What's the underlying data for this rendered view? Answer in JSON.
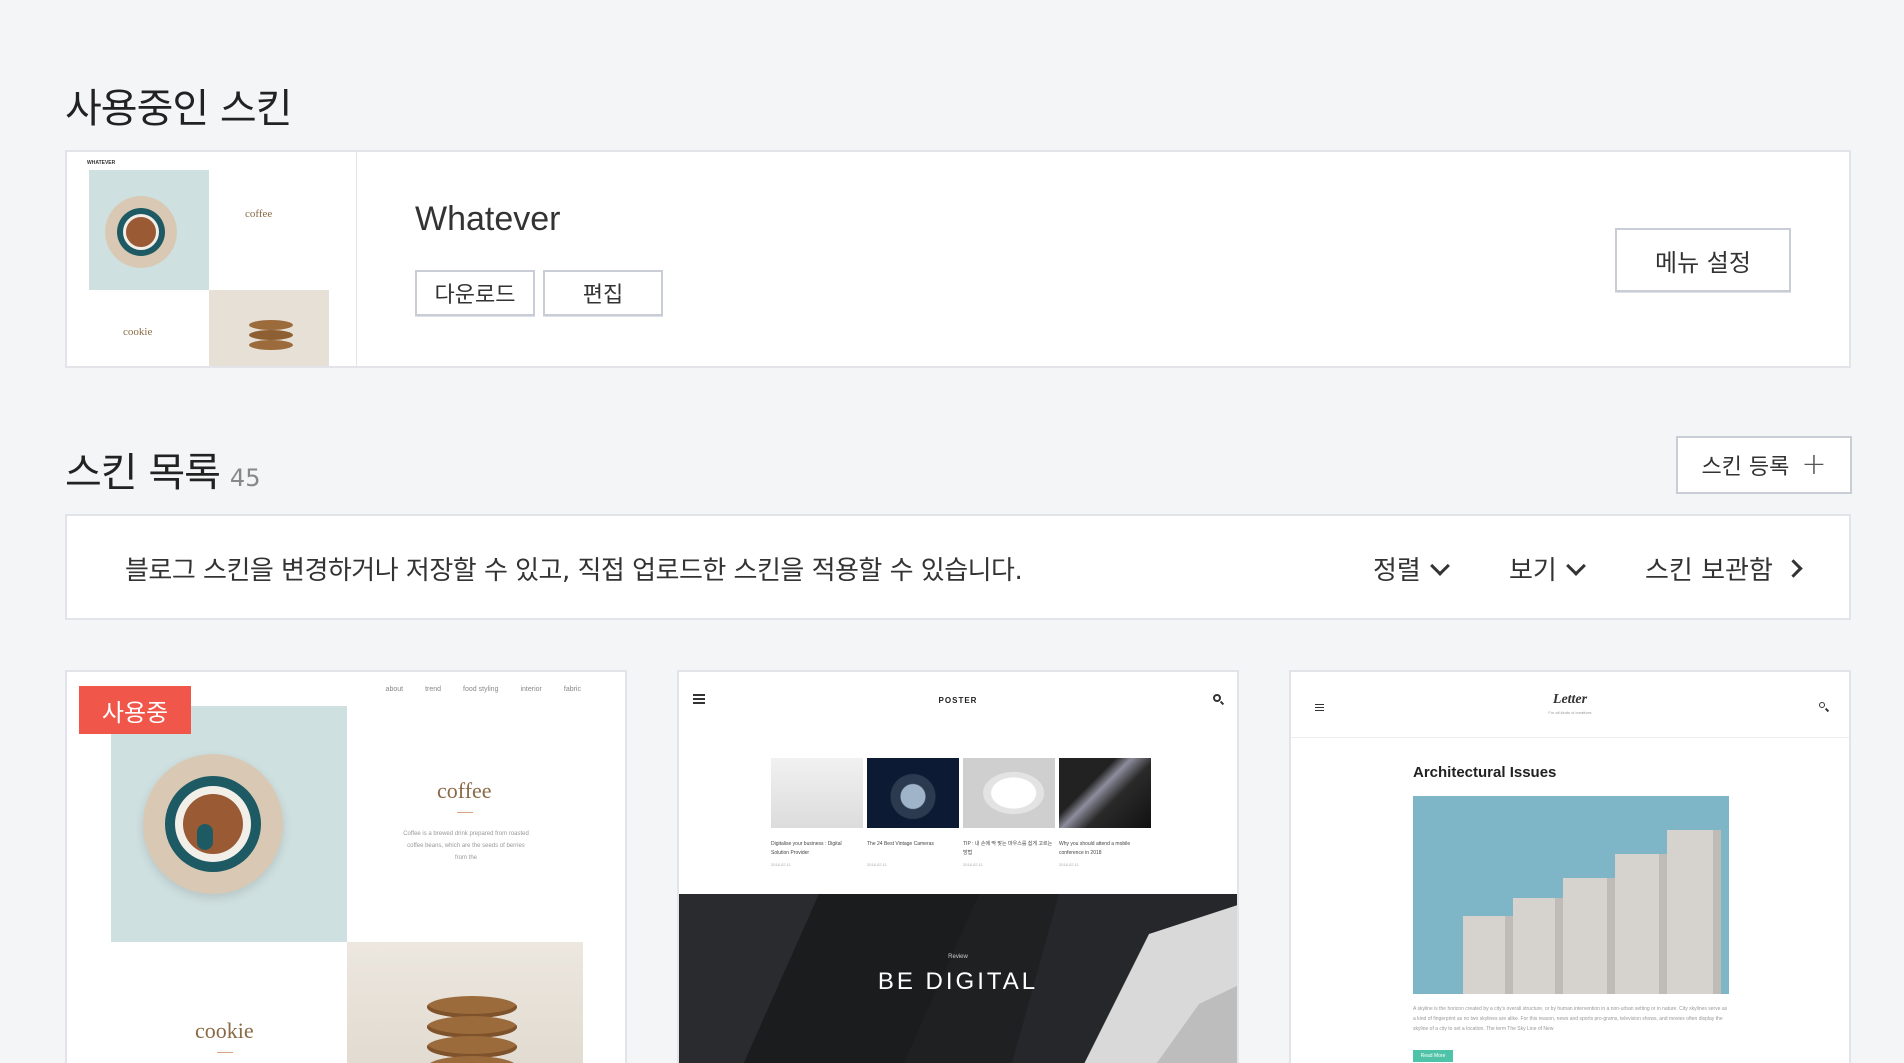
{
  "current": {
    "section_title": "사용중인 스킨",
    "skin_name": "Whatever",
    "download_label": "다운로드",
    "edit_label": "편집",
    "menu_settings_label": "메뉴 설정",
    "thumb": {
      "logo": "WHATEVER",
      "word_coffee": "coffee",
      "word_cookie": "cookie"
    }
  },
  "list": {
    "section_title": "스킨 목록",
    "count": "45",
    "register_label": "스킨 등록",
    "info_text": "블로그 스킨을 변경하거나 저장할 수 있고, 직접 업로드한 스킨을 적용할 수 있습니다.",
    "sort_label": "정렬",
    "view_label": "보기",
    "storage_label": "스킨 보관함"
  },
  "cards": {
    "whatever": {
      "badge": "사용중",
      "nav": [
        "about",
        "trend",
        "food styling",
        "interior",
        "fabric"
      ],
      "word_coffee": "coffee",
      "coffee_desc": "Coffee is a brewed drink prepared from roasted coffee beans, which are the seeds of berries from the",
      "word_cookie": "cookie"
    },
    "poster": {
      "logo": "POSTER",
      "captions": [
        "Digitalise your business : Digital Solution Provider",
        "The 24 Best Vintage Cameras",
        "TIP : 내 손에 딱 맞는 마우스를 쉽게 고르는 방법",
        "Why you should attend a mobile conference in 2018"
      ],
      "dates": [
        "2018.02.11",
        "2018.02.11",
        "2018.02.11",
        "2018.02.11"
      ],
      "hero_kicker": "Review",
      "hero_title": "BE DIGITAL"
    },
    "letter": {
      "logo": "Letter",
      "tagline": "For all kinds of creatives",
      "post_title": "Architectural Issues",
      "post_text": "A skyline is the horizon created by a city's overall structure, or by human intervention in a non-urban setting or in nature. City skylines serve as a kind of fingerprint as no two skylines are alike. For this reason, news and sports pro-grams, television shows, and movies often display the skyline of a city to set a location. The term The Sky Line of New",
      "read_more": "Read More"
    }
  },
  "colors": {
    "badge": "#f0564a",
    "background": "#f4f5f7",
    "border": "#e2e4e9"
  }
}
